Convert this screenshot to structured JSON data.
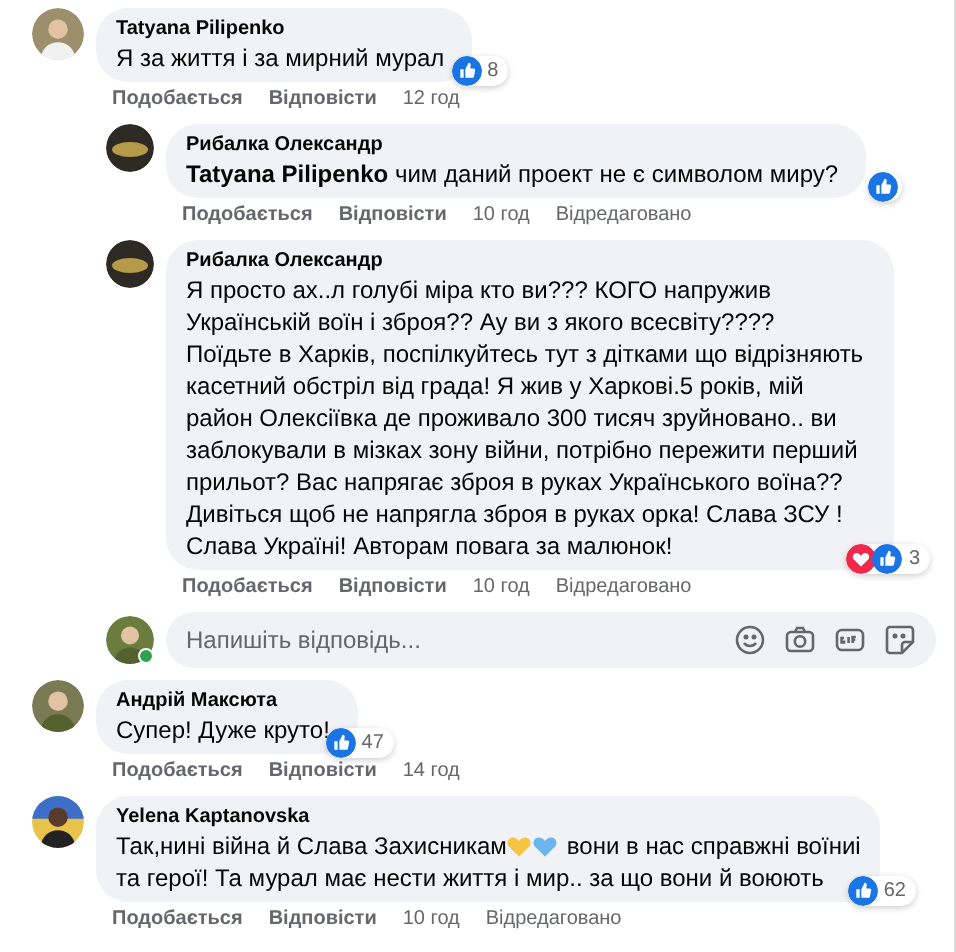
{
  "comments": [
    {
      "author": "Tatyana Pilipenko",
      "body": "Я за життя і за мирний мурал",
      "reactions": [
        {
          "kind": "like"
        }
      ],
      "reaction_count": "8",
      "like": "Подобається",
      "reply": "Відповісти",
      "time": "12 год",
      "replies": [
        {
          "author": "Рибалка Олександр",
          "body": "**Tatyana Pilipenko** чим даний проект не є символом миру?",
          "reactions": [
            {
              "kind": "like"
            }
          ],
          "like": "Подобається",
          "reply": "Відповісти",
          "time": "10 год",
          "edited": "Відредаговано"
        },
        {
          "author": "Рибалка Олександр",
          "body": "Я просто ах..л голубі міра кто ви??? КОГО напружив Українській воїн і зброя?? Ау ви з якого всесвіту???? Поїдьте в Харків, поспілкуйтесь тут з дітками що відрізняють касетний обстріл від града! Я жив у Харкові.5 років, мій район Олексіївка де проживало 300 тисяч зруйновано.. ви заблокували в мізках зону війни, потрібно пережити перший прильот? Вас напрягає зброя в руках Українського воїна?? Дивіться щоб не напрягла зброя в руках орка! Слава ЗСУ ! Слава Україні! Авторам повага за малюнок!",
          "reactions": [
            {
              "kind": "love"
            },
            {
              "kind": "like"
            }
          ],
          "reaction_count": "3",
          "like": "Подобається",
          "reply": "Відповісти",
          "time": "10 год",
          "edited": "Відредаговано"
        }
      ],
      "reply_box": {
        "placeholder": "Напишіть відповідь..."
      }
    },
    {
      "author": "Андрій Максюта",
      "body": "Супер! Дуже круто!",
      "reactions": [
        {
          "kind": "like"
        }
      ],
      "reaction_count": "47",
      "like": "Подобається",
      "reply": "Відповісти",
      "time": "14 год"
    },
    {
      "author": "Yelena Kaptanovska",
      "body": "Так,нині війна й Слава Захисникам",
      "hearts": [
        {
          "color": "#f5c542"
        },
        {
          "color": "#6cb4ee"
        }
      ],
      "body_after": "вони в нас справжні воїниі",
      "body_line2": "та герої! Та мурал має нести життя і мир.. за що вони й воюють",
      "reactions": [
        {
          "kind": "like"
        }
      ],
      "reaction_count": "62",
      "like": "Подобається",
      "reply": "Відповісти",
      "time": "10 год",
      "edited": "Відредаговано"
    }
  ]
}
